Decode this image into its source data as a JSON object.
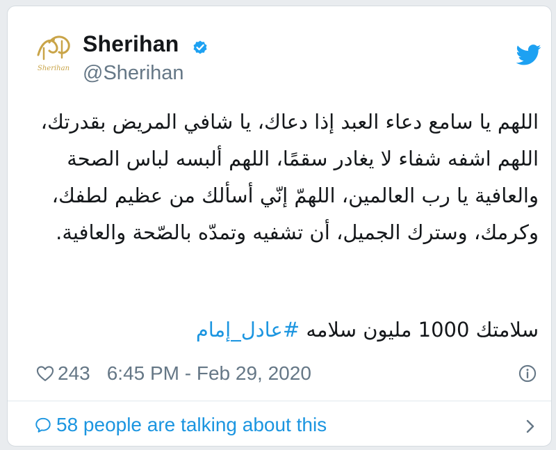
{
  "colors": {
    "link": "#1b95e0",
    "text": "#14171a",
    "muted": "#657786",
    "verified": "#1da1f2"
  },
  "tweet": {
    "author_name": "Sherihan",
    "author_handle": "@Sherihan",
    "avatar_icon": "sherihan-calligraphy-logo",
    "avatar_logo_text": "Sherihan",
    "body": "اللهم يا سامع دعاء العبد إذا دعاك، يا شافي المريض بقدرتك، اللهم اشفه شفاء لا يغادر سقمًا، اللهم ألبسه لباس الصحة والعافية يا رب العالمين، اللهمّ إنّي أسألك من عظيم لطفك، وكرمك، وسترك الجميل، أن تشفيه وتمدّه بالصّحة والعافية.",
    "closing_text": "سلامتك 1000 مليون سلامه",
    "hashtag": "#عادل_إمام",
    "likes": "243",
    "timestamp": "6:45 PM - Feb 29, 2020",
    "talking": "58 people are talking about this"
  },
  "icons": {
    "verified": "verified-badge-icon",
    "platform": "twitter-bird-icon",
    "like": "heart-icon",
    "info": "info-icon",
    "reply": "speech-bubble-icon",
    "more": "chevron-right-icon"
  }
}
